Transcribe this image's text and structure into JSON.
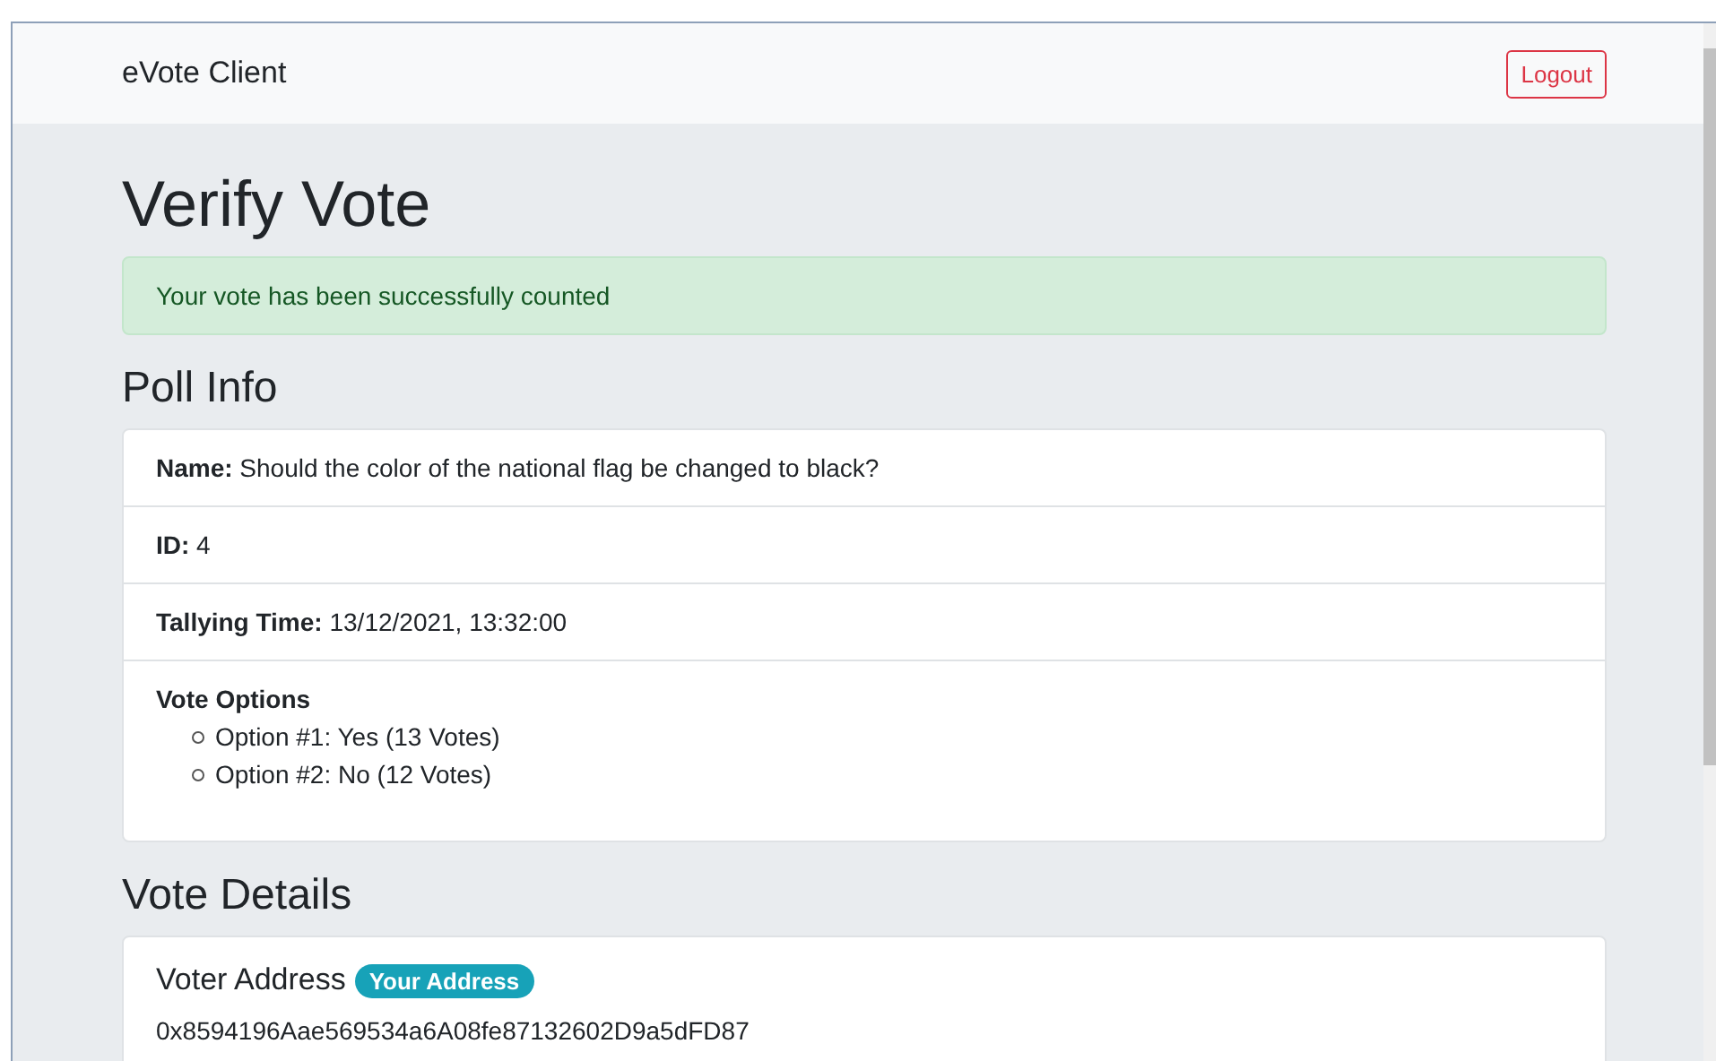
{
  "navbar": {
    "brand": "eVote Client",
    "logout_button": "Logout"
  },
  "page_title": "Verify Vote",
  "alert": "Your vote has been successfully counted",
  "poll_info": {
    "heading": "Poll Info",
    "rows": [
      {
        "kind": "field",
        "text": "**Name:** Should the color of the national flag be changed to black?"
      },
      {
        "kind": "field",
        "text": "**ID:** 4"
      },
      {
        "kind": "field",
        "text": "**Tallying Time:** 13/12/2021, 13:32:00"
      },
      {
        "kind": "list",
        "title": "Vote Options",
        "items": [
          "Option #1: Yes (13 Votes)",
          "Option #2: No (12 Votes)"
        ]
      }
    ]
  },
  "vote_details": {
    "heading": "Vote Details",
    "voter_address_label": "Voter Address",
    "badge": "Your Address",
    "address": "0x8594196Aae569534a6A08fe87132602D9a5dFD87"
  }
}
